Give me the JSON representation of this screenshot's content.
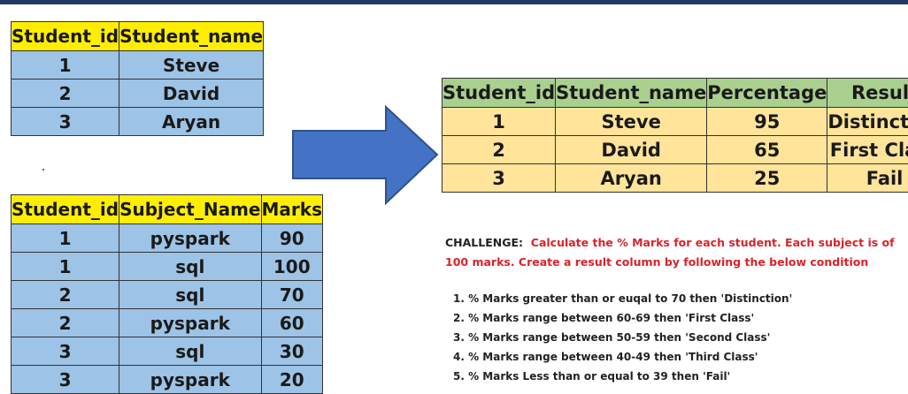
{
  "students_table": {
    "headers": [
      "Student_id",
      "Student_name"
    ],
    "rows": [
      [
        "1",
        "Steve"
      ],
      [
        "2",
        "David"
      ],
      [
        "3",
        "Aryan"
      ]
    ]
  },
  "marks_table": {
    "headers": [
      "Student_id",
      "Subject_Name",
      "Marks"
    ],
    "rows": [
      [
        "1",
        "pyspark",
        "90"
      ],
      [
        "1",
        "sql",
        "100"
      ],
      [
        "2",
        "sql",
        "70"
      ],
      [
        "2",
        "pyspark",
        "60"
      ],
      [
        "3",
        "sql",
        "30"
      ],
      [
        "3",
        "pyspark",
        "20"
      ]
    ]
  },
  "result_table": {
    "headers": [
      "Student_id",
      "Student_name",
      "Percentage",
      "Result"
    ],
    "rows": [
      [
        "1",
        "Steve",
        "95",
        "Distinction"
      ],
      [
        "2",
        "David",
        "65",
        "First Class"
      ],
      [
        "3",
        "Aryan",
        "25",
        "Fail"
      ]
    ]
  },
  "challenge": {
    "label": "CHALLENGE:",
    "text": "Calculate the % Marks for each student. Each subject is of 100 marks. Create a result column by following the below condition"
  },
  "rules": [
    "1. % Marks greater than or euqal to 70 then 'Distinction'",
    "2. % Marks range between 60-69 then 'First Class'",
    "3. % Marks range between 50-59 then 'Second Class'",
    "4. % Marks range between 40-49 then 'Third Class'",
    "5. % Marks Less than or equal to 39 then 'Fail'"
  ],
  "colors": {
    "header_yellow": "#ffee00",
    "cell_blue": "#9dc3e6",
    "header_green": "#a9d08e",
    "cell_orange": "#ffe49a",
    "arrow_blue": "#4472c4",
    "challenge_red": "#d9232a"
  },
  "icons": {
    "arrow": "right-arrow-icon"
  }
}
